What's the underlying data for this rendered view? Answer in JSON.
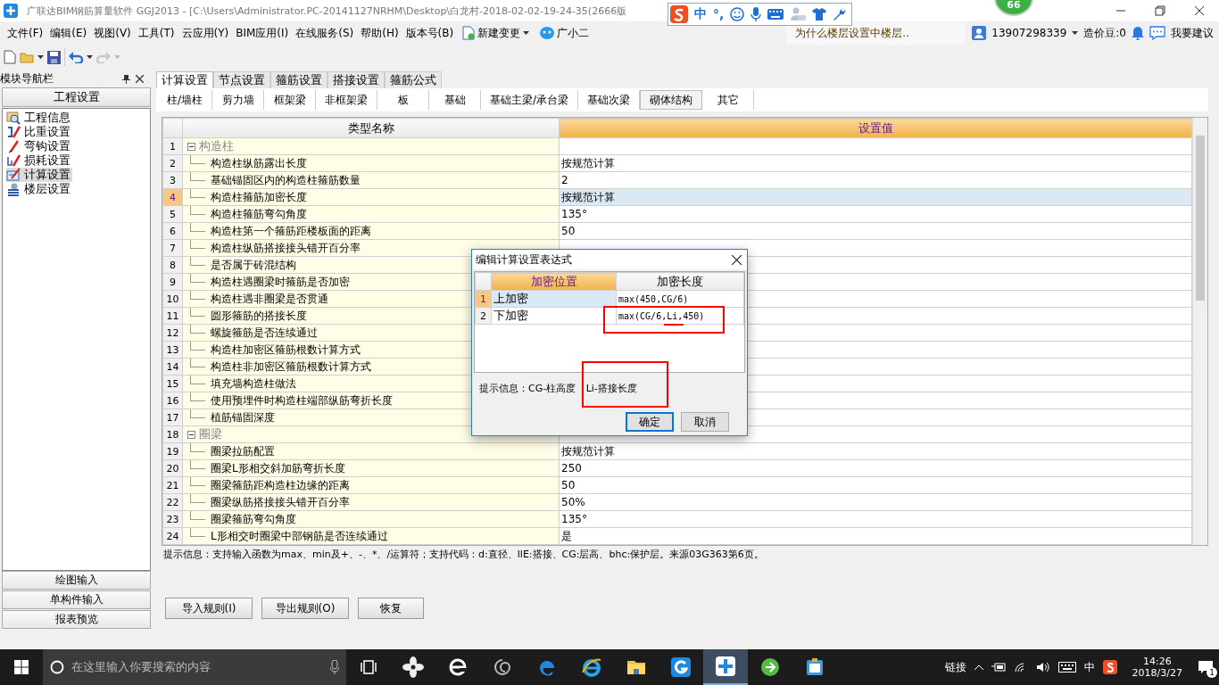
{
  "title_bar": {
    "title": "广联达BIM钢筋算量软件 GGJ2013 - [C:\\Users\\Administrator.PC-20141127NRHM\\Desktop\\白龙村-2018-02-02-19-24-35(2666版"
  },
  "ime_bar": {
    "mode": "中",
    "punct": "°,"
  },
  "float_ball": {
    "value": "66"
  },
  "menu": [
    "文件(F)",
    "编辑(E)",
    "视图(V)",
    "工具(T)",
    "云应用(Y)",
    "BIM应用(I)",
    "在线服务(S)",
    "帮助(H)",
    "版本号(B)"
  ],
  "menu_extras": [
    {
      "kind": "change",
      "label": "新建变更"
    },
    {
      "kind": "assistant",
      "label": "广小二"
    }
  ],
  "header_right": {
    "question": "为什么楼层设置中楼层..",
    "account": "13907298339",
    "beans": "造价豆:0",
    "feedback": "我要建议"
  },
  "toolbar": {
    "redo": {
      "disabled": true
    }
  },
  "nav": {
    "title": "模块导航栏",
    "section": "工程设置",
    "items": [
      {
        "label": "工程信息",
        "kind": "info",
        "selected": false
      },
      {
        "label": "比重设置",
        "kind": "weight",
        "selected": false
      },
      {
        "label": "弯钩设置",
        "kind": "hook",
        "selected": false
      },
      {
        "label": "损耗设置",
        "kind": "loss",
        "selected": false
      },
      {
        "label": "计算设置",
        "kind": "calc",
        "selected": true
      },
      {
        "label": "楼层设置",
        "kind": "floor",
        "selected": false
      }
    ],
    "bottom": [
      "绘图输入",
      "单构件输入",
      "报表预览"
    ]
  },
  "tabs": [
    {
      "label": "计算设置",
      "selected": true
    },
    {
      "label": "节点设置",
      "selected": false
    },
    {
      "label": "箍筋设置",
      "selected": false
    },
    {
      "label": "搭接设置",
      "selected": false
    },
    {
      "label": "箍筋公式",
      "selected": false
    }
  ],
  "subtabs": [
    {
      "label": "柱/墙柱",
      "selected": false
    },
    {
      "label": "剪力墙",
      "selected": false
    },
    {
      "label": "框架梁",
      "selected": false
    },
    {
      "label": "非框架梁",
      "selected": false
    },
    {
      "label": "板",
      "selected": false
    },
    {
      "label": "基础",
      "selected": false
    },
    {
      "label": "基础主梁/承台梁",
      "selected": false
    },
    {
      "label": "基础次梁",
      "selected": false
    },
    {
      "label": "砌体结构",
      "selected": true
    },
    {
      "label": "其它",
      "selected": false
    }
  ],
  "table": {
    "columns": [
      {
        "label": "类型名称",
        "selected": false
      },
      {
        "label": "设置值",
        "selected": true
      }
    ],
    "rows": [
      {
        "no": "1",
        "kind": "group",
        "expanded": true,
        "name": "构造柱",
        "selected": false
      },
      {
        "no": "2",
        "kind": "item",
        "name": "构造柱纵筋露出长度",
        "value": "按规范计算",
        "selected": false
      },
      {
        "no": "3",
        "kind": "item",
        "name": "基础锚固区内的构造柱箍筋数量",
        "value": "2",
        "selected": false
      },
      {
        "no": "4",
        "kind": "item",
        "name": "构造柱箍筋加密长度",
        "value": "按规范计算",
        "selected": true
      },
      {
        "no": "5",
        "kind": "item",
        "name": "构造柱箍筋弯勾角度",
        "value": "135°",
        "selected": false
      },
      {
        "no": "6",
        "kind": "item",
        "name": "构造柱第一个箍筋距楼板面的距离",
        "value": "50",
        "selected": false
      },
      {
        "no": "7",
        "kind": "item",
        "name": "构造柱纵筋搭接接头错开百分率",
        "selected": false
      },
      {
        "no": "8",
        "kind": "item",
        "name": "是否属于砖混结构",
        "selected": false
      },
      {
        "no": "9",
        "kind": "item",
        "name": "构造柱遇圈梁时箍筋是否加密",
        "selected": false
      },
      {
        "no": "10",
        "kind": "item",
        "name": "构造柱遇非圈梁是否贯通",
        "selected": false
      },
      {
        "no": "11",
        "kind": "item",
        "name": "圆形箍筋的搭接长度",
        "selected": false
      },
      {
        "no": "12",
        "kind": "item",
        "name": "螺旋箍筋是否连续通过",
        "selected": false
      },
      {
        "no": "13",
        "kind": "item",
        "name": "构造柱加密区箍筋根数计算方式",
        "selected": false
      },
      {
        "no": "14",
        "kind": "item",
        "name": "构造柱非加密区箍筋根数计算方式",
        "selected": false
      },
      {
        "no": "15",
        "kind": "item",
        "name": "填充墙构造柱做法",
        "selected": false
      },
      {
        "no": "16",
        "kind": "item",
        "name": "使用预埋件时构造柱端部纵筋弯折长度",
        "selected": false
      },
      {
        "no": "17",
        "kind": "item",
        "name": "植筋锚固深度",
        "selected": false
      },
      {
        "no": "18",
        "kind": "group",
        "expanded": true,
        "name": "圈梁",
        "selected": false
      },
      {
        "no": "19",
        "kind": "item",
        "name": "圈梁拉筋配置",
        "value": "按规范计算",
        "selected": false
      },
      {
        "no": "20",
        "kind": "item",
        "name": "圈梁L形相交斜加筋弯折长度",
        "value": "250",
        "selected": false
      },
      {
        "no": "21",
        "kind": "item",
        "name": "圈梁箍筋距构造柱边缘的距离",
        "value": "50",
        "selected": false
      },
      {
        "no": "22",
        "kind": "item",
        "name": "圈梁纵筋搭接接头错开百分率",
        "value": "50%",
        "selected": false
      },
      {
        "no": "23",
        "kind": "item",
        "name": "圈梁箍筋弯勾角度",
        "value": "135°",
        "selected": false
      },
      {
        "no": "24",
        "kind": "item",
        "name": "L形相交时圈梁中部钢筋是否连续通过",
        "value": "是",
        "selected": false
      }
    ]
  },
  "hint": "提示信息：支持输入函数为max、min及+、-、*、/运算符；支持代码：d:直径、llE:搭接、CG:层高、bhc:保护层。来源03G363第6页。",
  "buttons": [
    "导入规则(I)",
    "导出规则(O)",
    "恢复"
  ],
  "dialog": {
    "title": "编辑计算设置表达式",
    "columns": [
      {
        "label": "加密位置",
        "selected": true
      },
      {
        "label": "加密长度",
        "selected": false
      }
    ],
    "rows": [
      {
        "no": "1",
        "position": "上加密",
        "length": "max(450,CG/6)",
        "selected": true
      },
      {
        "no": "2",
        "position": "下加密",
        "length": "max(CG/6,Li,450)",
        "selected": false
      }
    ],
    "hint": "提示信息：CG-柱高度 Li-搭接长度",
    "buttons": [
      {
        "label": "确定",
        "kind": "default"
      },
      {
        "label": "取消",
        "kind": "normal"
      }
    ]
  },
  "taskbar": {
    "search_placeholder": "在这里输入你要搜索的内容",
    "apps": [
      {
        "kind": "taskview",
        "selected": false
      },
      {
        "kind": "fan",
        "selected": false
      },
      {
        "kind": "ebrowser",
        "selected": false
      },
      {
        "kind": "spiral",
        "selected": false
      },
      {
        "kind": "edge",
        "selected": false
      },
      {
        "kind": "ie",
        "selected": false
      },
      {
        "kind": "folder",
        "selected": false
      },
      {
        "kind": "gapp",
        "selected": false
      },
      {
        "kind": "plusapp",
        "selected": true
      },
      {
        "kind": "greenapp",
        "selected": false
      },
      {
        "kind": "clipboard",
        "selected": false
      }
    ],
    "link": "链接",
    "ime": "中",
    "time": "14:26",
    "date": "2018/3/27",
    "notifications": "1"
  }
}
